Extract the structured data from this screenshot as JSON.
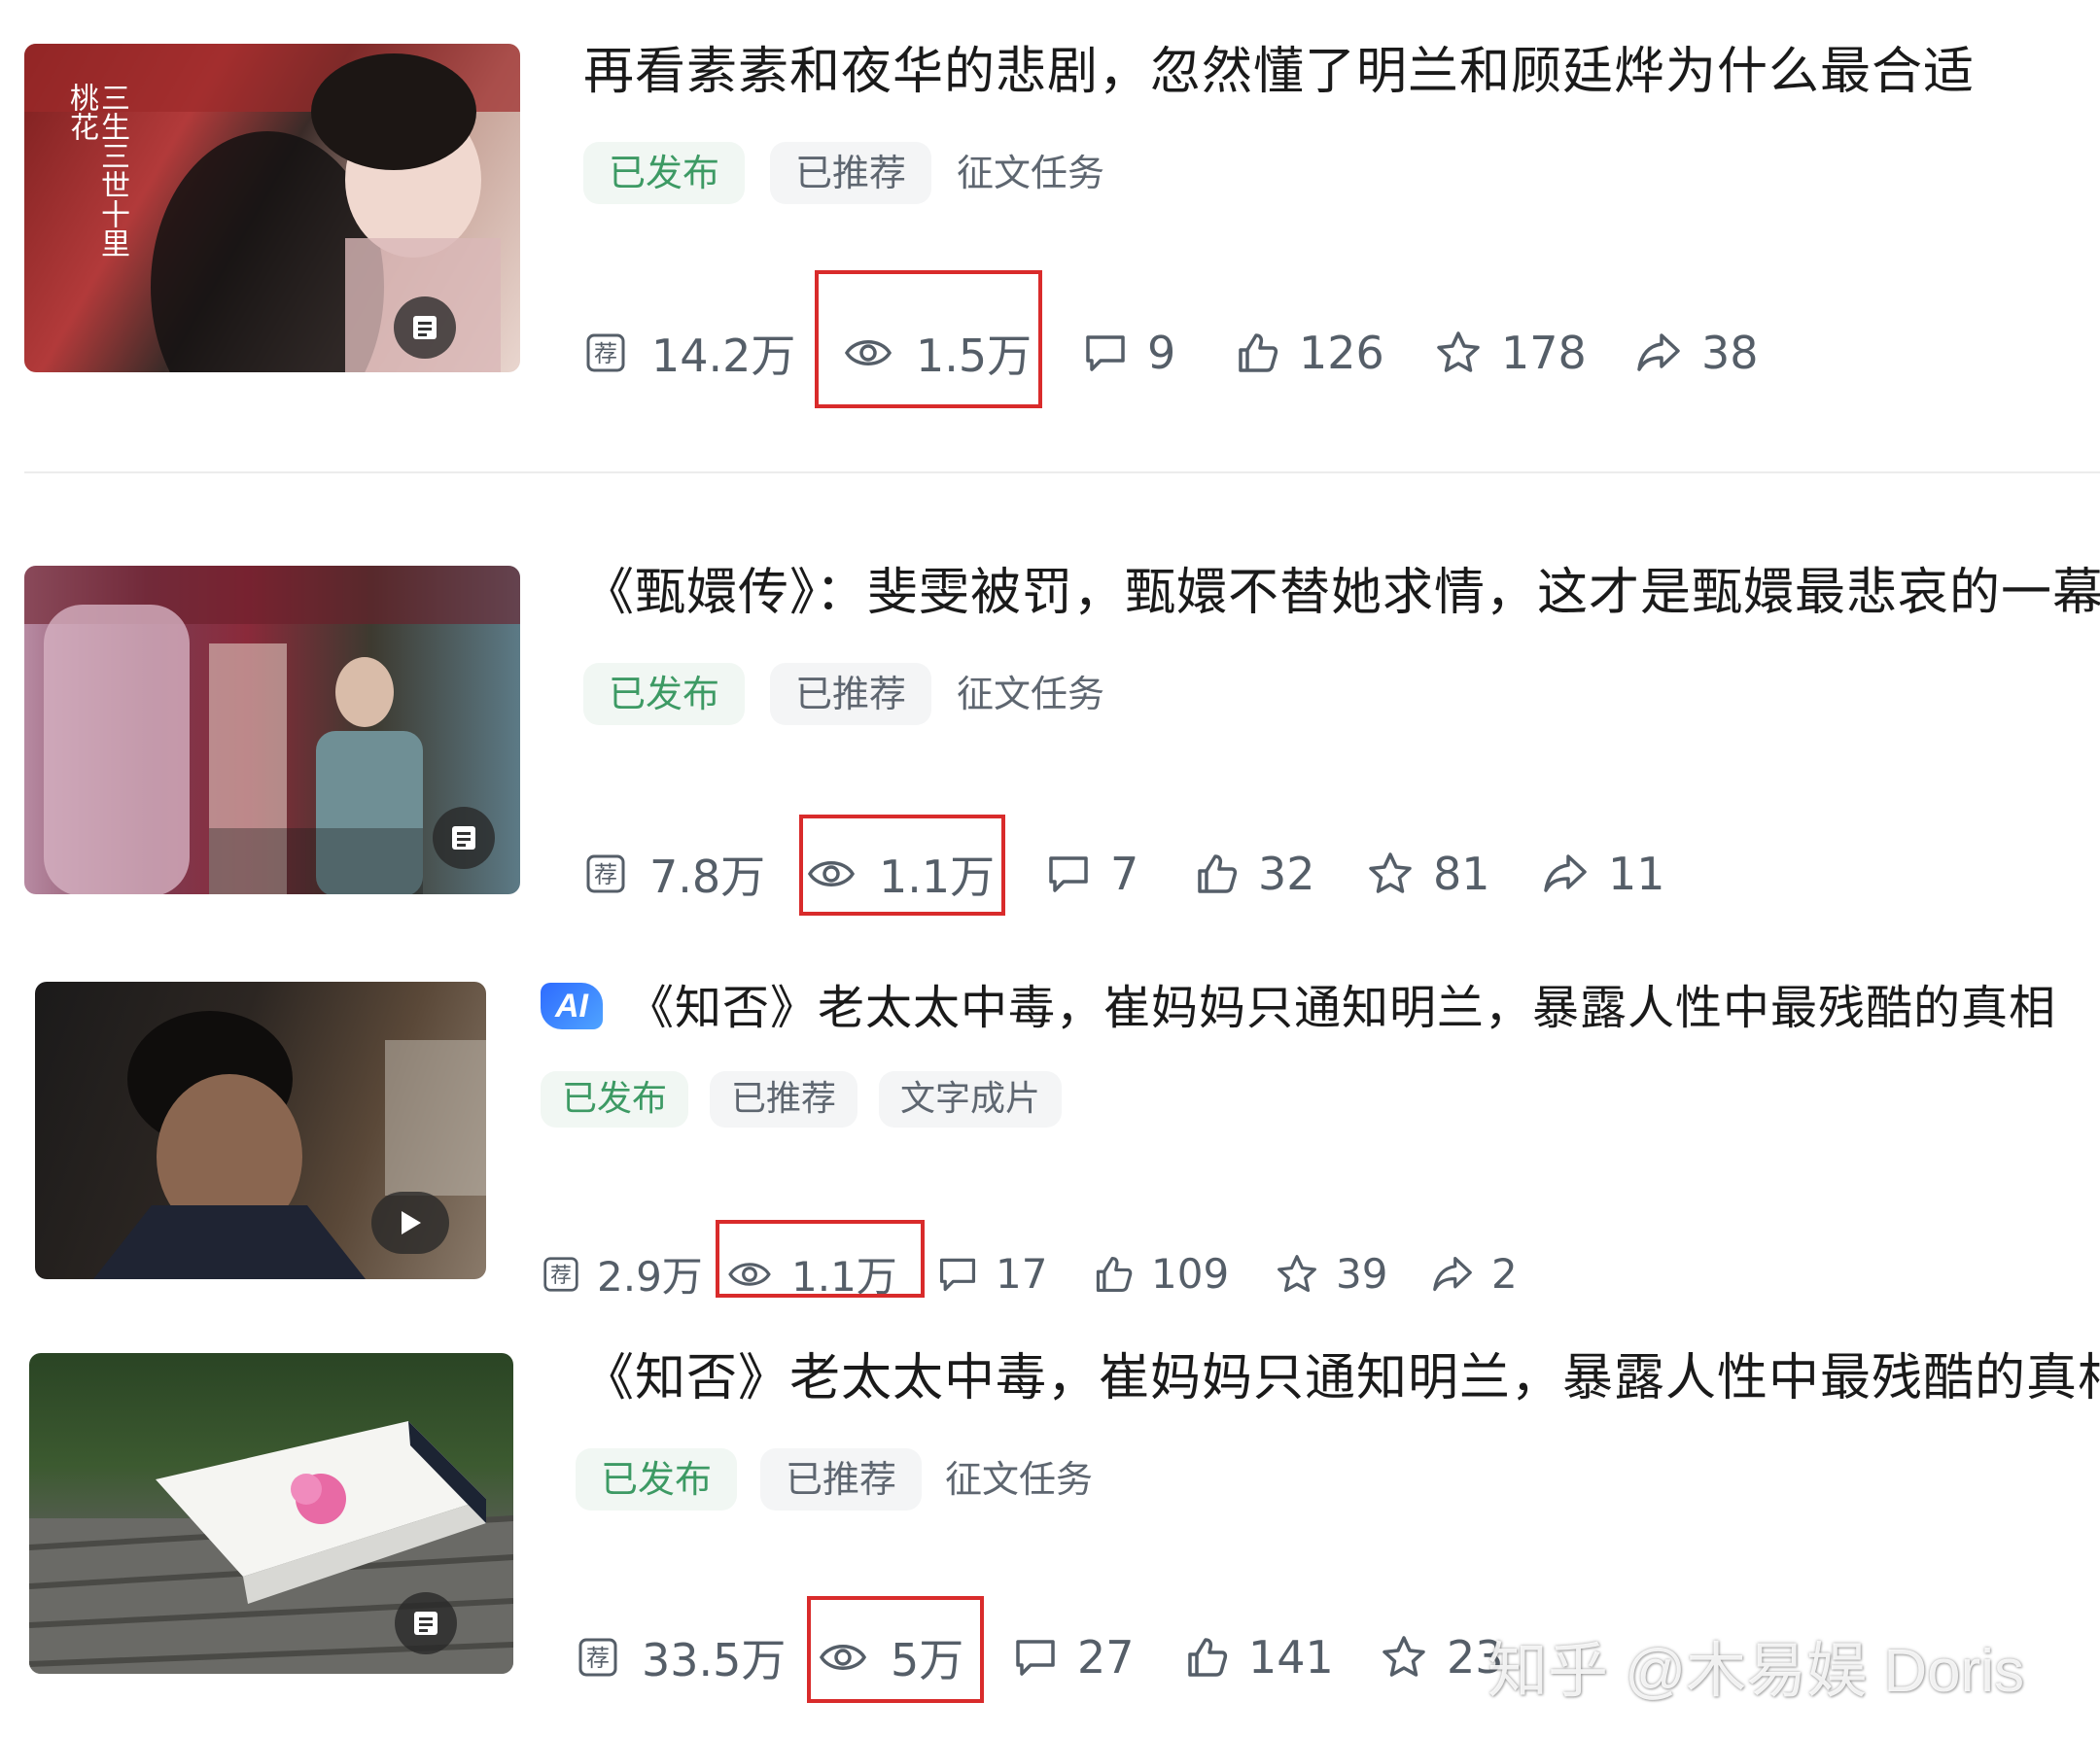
{
  "articles": [
    {
      "title": "再看素素和夜华的悲剧，忽然懂了明兰和顾廷烨为什么最合适",
      "tags": [
        "已发布",
        "已推荐",
        "征文任务"
      ],
      "thumbnail": {
        "type": "article",
        "caption": "三生三世十里桃花"
      },
      "stats": {
        "recommend": "14.2万",
        "views": "1.5万",
        "comments": "9",
        "likes": "126",
        "favorites": "178",
        "shares": "38"
      }
    },
    {
      "title": "《甄嬛传》：斐雯被罚，甄嬛不替她求情，这才是甄嬛最悲哀的一幕",
      "tags": [
        "已发布",
        "已推荐",
        "征文任务"
      ],
      "thumbnail": {
        "type": "article"
      },
      "stats": {
        "recommend": "7.8万",
        "views": "1.1万",
        "comments": "7",
        "likes": "32",
        "favorites": "81",
        "shares": "11"
      }
    },
    {
      "ai_badge": "AI",
      "title": "《知否》老太太中毒，崔妈妈只通知明兰，暴露人性中最残酷的真相",
      "tags": [
        "已发布",
        "已推荐",
        "文字成片"
      ],
      "thumbnail": {
        "type": "video"
      },
      "stats": {
        "recommend": "2.9万",
        "views": "1.1万",
        "comments": "17",
        "likes": "109",
        "favorites": "39",
        "shares": "2"
      }
    },
    {
      "title": "《知否》老太太中毒，崔妈妈只通知明兰，暴露人性中最残酷的真相",
      "tags": [
        "已发布",
        "已推荐",
        "征文任务"
      ],
      "thumbnail": {
        "type": "article"
      },
      "stats": {
        "recommend": "33.5万",
        "views": "5万",
        "comments": "27",
        "likes": "141",
        "favorites": "23"
      }
    }
  ],
  "watermark": "知乎 @木易娱 Doris",
  "colors": {
    "highlight": "#d92b2b",
    "published": "#3d9a64",
    "text": "#1a1a1a",
    "stat": "#555e68"
  }
}
